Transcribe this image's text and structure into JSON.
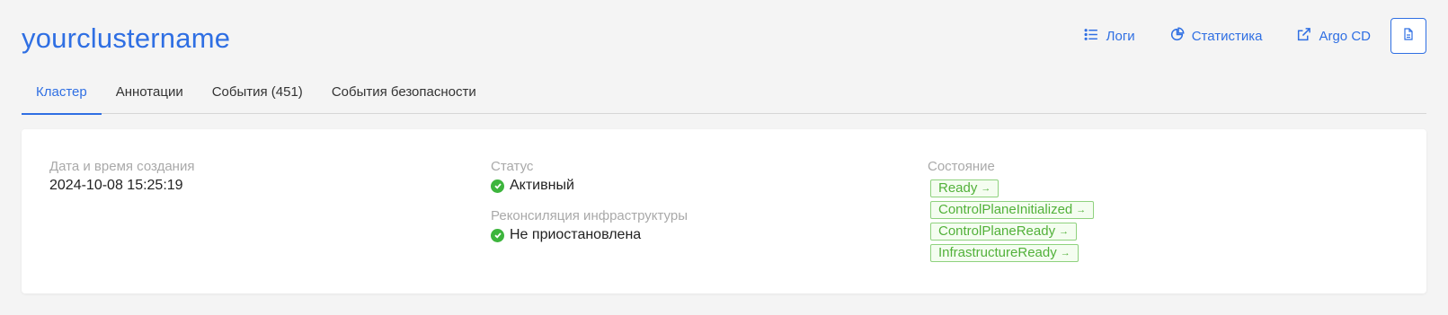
{
  "header": {
    "title": "yourclustername",
    "actions": {
      "logs_label": "Логи",
      "stats_label": "Статистика",
      "argocd_label": "Argo CD"
    }
  },
  "tabs": [
    {
      "label": "Кластер",
      "active": true
    },
    {
      "label": "Аннотации",
      "active": false
    },
    {
      "label": "События (451)",
      "active": false
    },
    {
      "label": "События безопасности",
      "active": false
    }
  ],
  "details": {
    "created": {
      "label": "Дата и время создания",
      "value": "2024-10-08 15:25:19"
    },
    "status": {
      "label": "Статус",
      "value": "Активный"
    },
    "reconciliation": {
      "label": "Реконсиляция инфраструктуры",
      "value": "Не приостановлена"
    },
    "state": {
      "label": "Состояние",
      "conditions": [
        "Ready",
        "ControlPlaneInitialized",
        "ControlPlaneReady",
        "InfrastructureReady"
      ]
    }
  },
  "colors": {
    "accent": "#2f6fe3",
    "success": "#3db53d",
    "badge_border": "#8fd27e",
    "badge_text": "#52b13a"
  }
}
